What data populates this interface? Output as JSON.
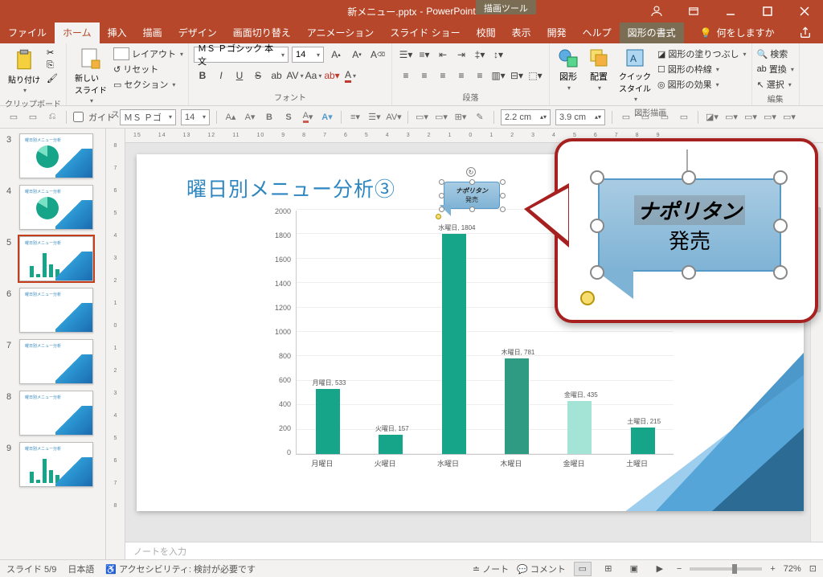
{
  "title": {
    "filename": "新メニュー.pptx",
    "app": "PowerPoint",
    "context_tab": "描画ツール"
  },
  "tabs": [
    "ファイル",
    "ホーム",
    "挿入",
    "描画",
    "デザイン",
    "画面切り替え",
    "アニメーション",
    "スライド ショー",
    "校閲",
    "表示",
    "開発",
    "ヘルプ",
    "図形の書式"
  ],
  "active_tab": "ホーム",
  "tell_me": "何をしますか",
  "ribbon": {
    "clipboard": {
      "label": "クリップボード",
      "paste": "貼り付け"
    },
    "slides": {
      "label": "スライド",
      "new_slide": "新しい\nスライド",
      "layout": "レイアウト",
      "reset": "リセット",
      "section": "セクション"
    },
    "font": {
      "label": "フォント",
      "name": "ＭＳ Ｐゴシック 本文",
      "size": "14"
    },
    "paragraph": {
      "label": "段落"
    },
    "drawing": {
      "label": "図形描画",
      "shapes": "図形",
      "arrange": "配置",
      "quick_styles": "クイック\nスタイル",
      "fill": "図形の塗りつぶし",
      "outline": "図形の枠線",
      "effects": "図形の効果"
    },
    "editing": {
      "label": "編集",
      "find": "検索",
      "replace": "置換",
      "select": "選択"
    }
  },
  "sec_toolbar": {
    "guide_label": "ガイド",
    "font_name": "ＭＳ Ｐゴ",
    "font_size": "14",
    "height": "2.2 cm",
    "width": "3.9 cm"
  },
  "ruler_h": [
    "15",
    "14",
    "13",
    "12",
    "11",
    "10",
    "9",
    "8",
    "7",
    "6",
    "5",
    "4",
    "3",
    "2",
    "1",
    "0",
    "1",
    "2",
    "3",
    "4",
    "5",
    "6",
    "7",
    "8",
    "9"
  ],
  "ruler_v": [
    "8",
    "7",
    "6",
    "5",
    "4",
    "3",
    "2",
    "1",
    "0",
    "1",
    "2",
    "3",
    "4",
    "5",
    "6",
    "7",
    "8"
  ],
  "thumbnails": [
    {
      "num": "3",
      "type": "pie"
    },
    {
      "num": "4",
      "type": "pie"
    },
    {
      "num": "5",
      "type": "bars",
      "selected": true
    },
    {
      "num": "6",
      "type": "blank"
    },
    {
      "num": "7",
      "type": "blank"
    },
    {
      "num": "8",
      "type": "blank"
    },
    {
      "num": "9",
      "type": "bars"
    }
  ],
  "slide": {
    "title": "曜日別メニュー分析③",
    "callout": {
      "line1": "ナポリタン",
      "line2": "発売"
    }
  },
  "chart_data": {
    "type": "bar",
    "title": "",
    "xlabel": "",
    "ylabel": "",
    "ylim": [
      0,
      2000
    ],
    "y_ticks": [
      0,
      200,
      400,
      600,
      800,
      1000,
      1200,
      1400,
      1600,
      1800,
      2000
    ],
    "categories": [
      "月曜日",
      "火曜日",
      "水曜日",
      "木曜日",
      "金曜日",
      "土曜日"
    ],
    "values": [
      533,
      157,
      1804,
      781,
      435,
      215
    ],
    "data_labels": [
      "月曜日, 533",
      "火曜日, 157",
      "水曜日, 1804",
      "木曜日, 781",
      "金曜日, 435",
      "土曜日, 215"
    ],
    "colors": [
      "#17a589",
      "#17a589",
      "#17a589",
      "#2e9b82",
      "#a3e4d7",
      "#17a589"
    ]
  },
  "notes_placeholder": "ノートを入力",
  "status": {
    "slide_info": "スライド 5/9",
    "language": "日本語",
    "accessibility": "アクセシビリティ: 検討が必要です",
    "notes": "ノート",
    "comments": "コメント",
    "zoom": "72%"
  }
}
